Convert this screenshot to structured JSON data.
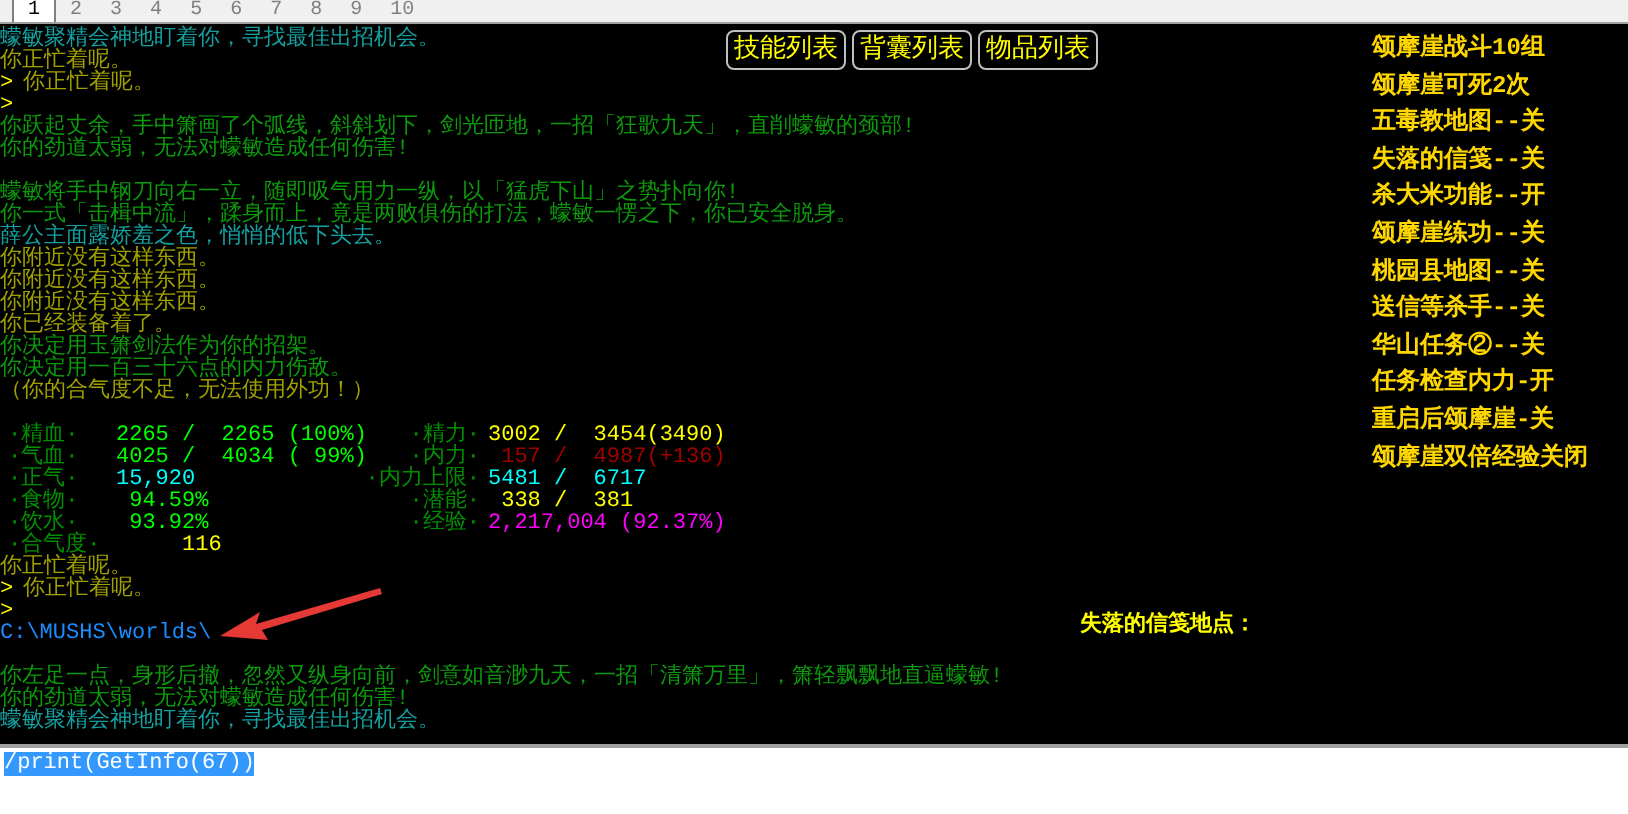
{
  "tabs": [
    {
      "label": "1",
      "selected": true
    },
    {
      "label": "2",
      "selected": false
    },
    {
      "label": "3",
      "selected": false
    },
    {
      "label": "4",
      "selected": false
    },
    {
      "label": "5",
      "selected": false
    },
    {
      "label": "6",
      "selected": false
    },
    {
      "label": "7",
      "selected": false
    },
    {
      "label": "8",
      "selected": false
    },
    {
      "label": "9",
      "selected": false
    },
    {
      "label": "10",
      "selected": false
    }
  ],
  "toolbar_buttons": [
    "技能列表",
    "背囊列表",
    "物品列表"
  ],
  "status_list": [
    "颂摩崖战斗10组",
    "颂摩崖可死2次",
    "五毒教地图--关",
    "失落的信笺--关",
    "杀大米功能--开",
    "颂摩崖练功--关",
    "桃园县地图--关",
    "送信等杀手--关",
    "华山任务②--关",
    "任务检查内力-开",
    "重启后颂摩崖-关",
    "颂摩崖双倍经验关闭"
  ],
  "output": [
    {
      "kind": "text",
      "text": "蠓敏聚精会神地盯着你，寻找最佳出招机会。",
      "color": "#14a0a0"
    },
    {
      "kind": "text",
      "text": "你正忙着呢。",
      "color": "#a0a000"
    },
    {
      "kind": "prompt",
      "prompt": ">",
      "text": "你正忙着呢。",
      "color": "#a0a000"
    },
    {
      "kind": "prompt",
      "prompt": ">"
    },
    {
      "kind": "text",
      "text": "你跃起丈余，手中箫画了个弧线，斜斜划下，剑光匝地，一招「狂歌九天」，直削蠓敏的颈部!",
      "color": "#0c9a0c"
    },
    {
      "kind": "text",
      "text": "你的劲道太弱，无法对蠓敏造成任何伤害!",
      "color": "#0c9a0c"
    },
    {
      "kind": "blank"
    },
    {
      "kind": "text",
      "text": "蠓敏将手中钢刀向右一立，随即吸气用力一纵，以「猛虎下山」之势扑向你!",
      "color": "#0c9a0c"
    },
    {
      "kind": "text",
      "text": "你一式「击楫中流」，蹂身而上，竟是两败俱伤的打法，蠓敏一愣之下，你已安全脱身。",
      "color": "#0c9a0c"
    },
    {
      "kind": "text",
      "text": "薛公主面露娇羞之色，悄悄的低下头去。",
      "color": "#14a0a0"
    },
    {
      "kind": "text",
      "text": "你附近没有这样东西。",
      "color": "#a0a000"
    },
    {
      "kind": "text",
      "text": "你附近没有这样东西。",
      "color": "#a0a000"
    },
    {
      "kind": "text",
      "text": "你附近没有这样东西。",
      "color": "#a0a000"
    },
    {
      "kind": "text",
      "text": "你已经装备着了。",
      "color": "#a0a000"
    },
    {
      "kind": "text",
      "text": "你决定用玉箫剑法作为你的招架。",
      "color": "#0c9a0c"
    },
    {
      "kind": "text",
      "text": "你决定用一百三十六点的内力伤敌。",
      "color": "#0c9a0c"
    },
    {
      "kind": "text",
      "text": "（你的合气度不足，无法使用外功！）",
      "color": "#a0a000"
    },
    {
      "kind": "blank"
    },
    {
      "kind": "stats",
      "rows": [
        {
          "left": {
            "label": "·精血·",
            "value": "2265 /  2265 (100%)",
            "color": "#00ff00"
          },
          "right": {
            "label": "·精力·",
            "value": "3002 /  3454(3490)",
            "color": "#ffff00"
          }
        },
        {
          "left": {
            "label": "·气血·",
            "value": "4025 /  4034 ( 99%)",
            "color": "#00ff00"
          },
          "right": {
            "label": "·内力·",
            "value": " 157 /  4987(+136)",
            "color": "#a00000"
          }
        },
        {
          "left": {
            "label": "·正气·",
            "value": "15,920",
            "color": "#00ffff"
          },
          "right": {
            "label": "·内力上限·",
            "value": "5481 /  6717",
            "color": "#00ffff"
          }
        },
        {
          "left": {
            "label": "·食物·",
            "value": " 94.59%",
            "color": "#00ff00"
          },
          "right": {
            "label": "·潜能·",
            "value": " 338 /  381",
            "color": "#ffff00"
          }
        },
        {
          "left": {
            "label": "·饮水·",
            "value": " 93.92%",
            "color": "#00ff00"
          },
          "right": {
            "label": "·经验·",
            "value": "2,217,004 (92.37%)",
            "color": "#ff00ff"
          }
        },
        {
          "left": {
            "label": "·合气度·",
            "value": "     116",
            "color": "#ffff00"
          }
        }
      ]
    },
    {
      "kind": "text",
      "text": "你正忙着呢。",
      "color": "#a0a000"
    },
    {
      "kind": "prompt",
      "prompt": ">",
      "text": "你正忙着呢。",
      "color": "#a0a000"
    },
    {
      "kind": "prompt",
      "prompt": ">"
    },
    {
      "kind": "path",
      "text": "C:\\MUSHS\\worlds\\",
      "color": "#1a8cff",
      "aside": "失落的信笺地点："
    },
    {
      "kind": "blank"
    },
    {
      "kind": "text",
      "text": "你左足一点，身形后撤，忽然又纵身向前，剑意如音渺九天，一招「清箫万里」，箫轻飘飘地直逼蠓敏!",
      "color": "#0c9a0c"
    },
    {
      "kind": "text",
      "text": "你的劲道太弱，无法对蠓敏造成任何伤害!",
      "color": "#0c9a0c"
    },
    {
      "kind": "text",
      "text": "蠓敏聚精会神地盯着你，寻找最佳出招机会。",
      "color": "#14a0a0"
    }
  ],
  "input": {
    "value": "/print(GetInfo(67))",
    "selected": true
  }
}
